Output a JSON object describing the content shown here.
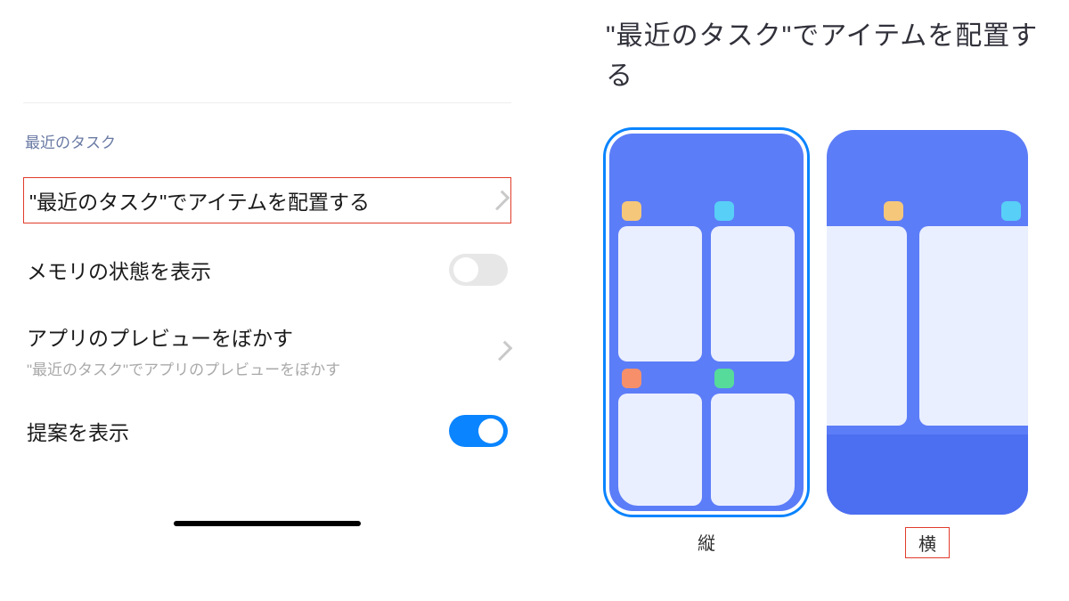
{
  "section_header": "最近のタスク",
  "rows": {
    "arrange": {
      "title": "\"最近のタスク\"でアイテムを配置する"
    },
    "memory": {
      "title": "メモリの状態を表示"
    },
    "blur": {
      "title": "アプリのプレビューをぼかす",
      "subtitle": "\"最近のタスク\"でアプリのプレビューをぼかす"
    },
    "suggest": {
      "title": "提案を表示"
    }
  },
  "page_title": "\"最近のタスク\"でアイテムを配置する",
  "options": {
    "vertical": {
      "label": "縦"
    },
    "horizontal": {
      "label": "横"
    }
  }
}
